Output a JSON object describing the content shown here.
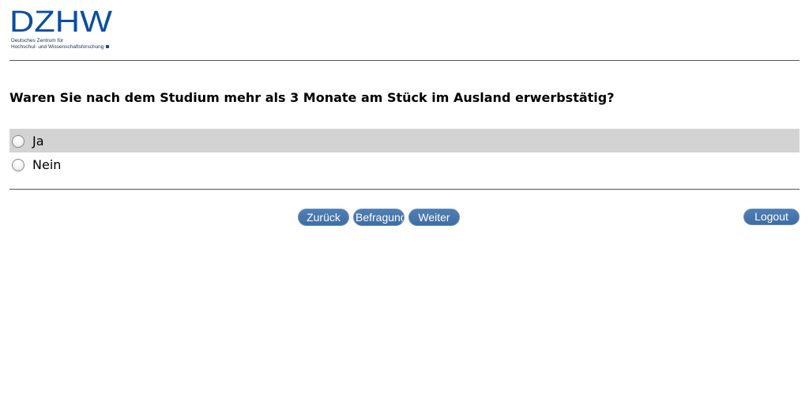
{
  "logo": {
    "wordmark": "DZHW",
    "subtitle_line1": "Deutsches Zentrum für",
    "subtitle_line2": "Hochschul- und Wissenschaftsforschung",
    "color": "#0b4ea2"
  },
  "question": {
    "text": "Waren Sie nach dem Studium mehr als 3 Monate am Stück im Ausland erwerbstätig?"
  },
  "options": [
    {
      "label": "Ja",
      "selected": false,
      "highlighted": true
    },
    {
      "label": "Nein",
      "selected": false,
      "highlighted": false
    }
  ],
  "navigation": {
    "back_label": "Zurück",
    "survey_label": "Befragung",
    "next_label": "Weiter",
    "logout_label": "Logout"
  },
  "colors": {
    "button": "#3d6da4",
    "highlight_row": "#d3d3d3",
    "rule": "#555555"
  }
}
